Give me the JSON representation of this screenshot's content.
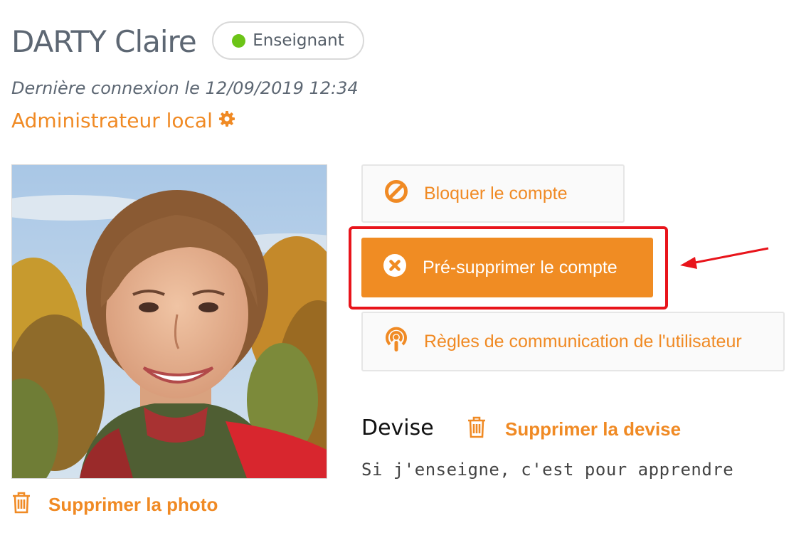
{
  "user": {
    "name": "DARTY Claire",
    "role": "Enseignant",
    "last_login": "Dernière connexion le 12/09/2019 12:34",
    "admin_link": "Administrateur local"
  },
  "photo": {
    "delete_label": "Supprimer la photo"
  },
  "actions": {
    "block_label": "Bloquer le compte",
    "presuppress_label": "Pré-supprimer le compte",
    "rules_label": "Règles de communication de l'utilisateur"
  },
  "motto": {
    "title": "Devise",
    "delete_label": "Supprimer la devise",
    "text": "Si j'enseigne, c'est pour apprendre"
  },
  "icons": {
    "admin": "gear-icon",
    "block": "ban-icon",
    "presuppress": "circle-x-icon",
    "rules": "podcast-icon",
    "delete": "trash-icon"
  },
  "colors": {
    "accent": "#f08a24",
    "status_online": "#6cc417",
    "highlight": "#e8141b"
  }
}
